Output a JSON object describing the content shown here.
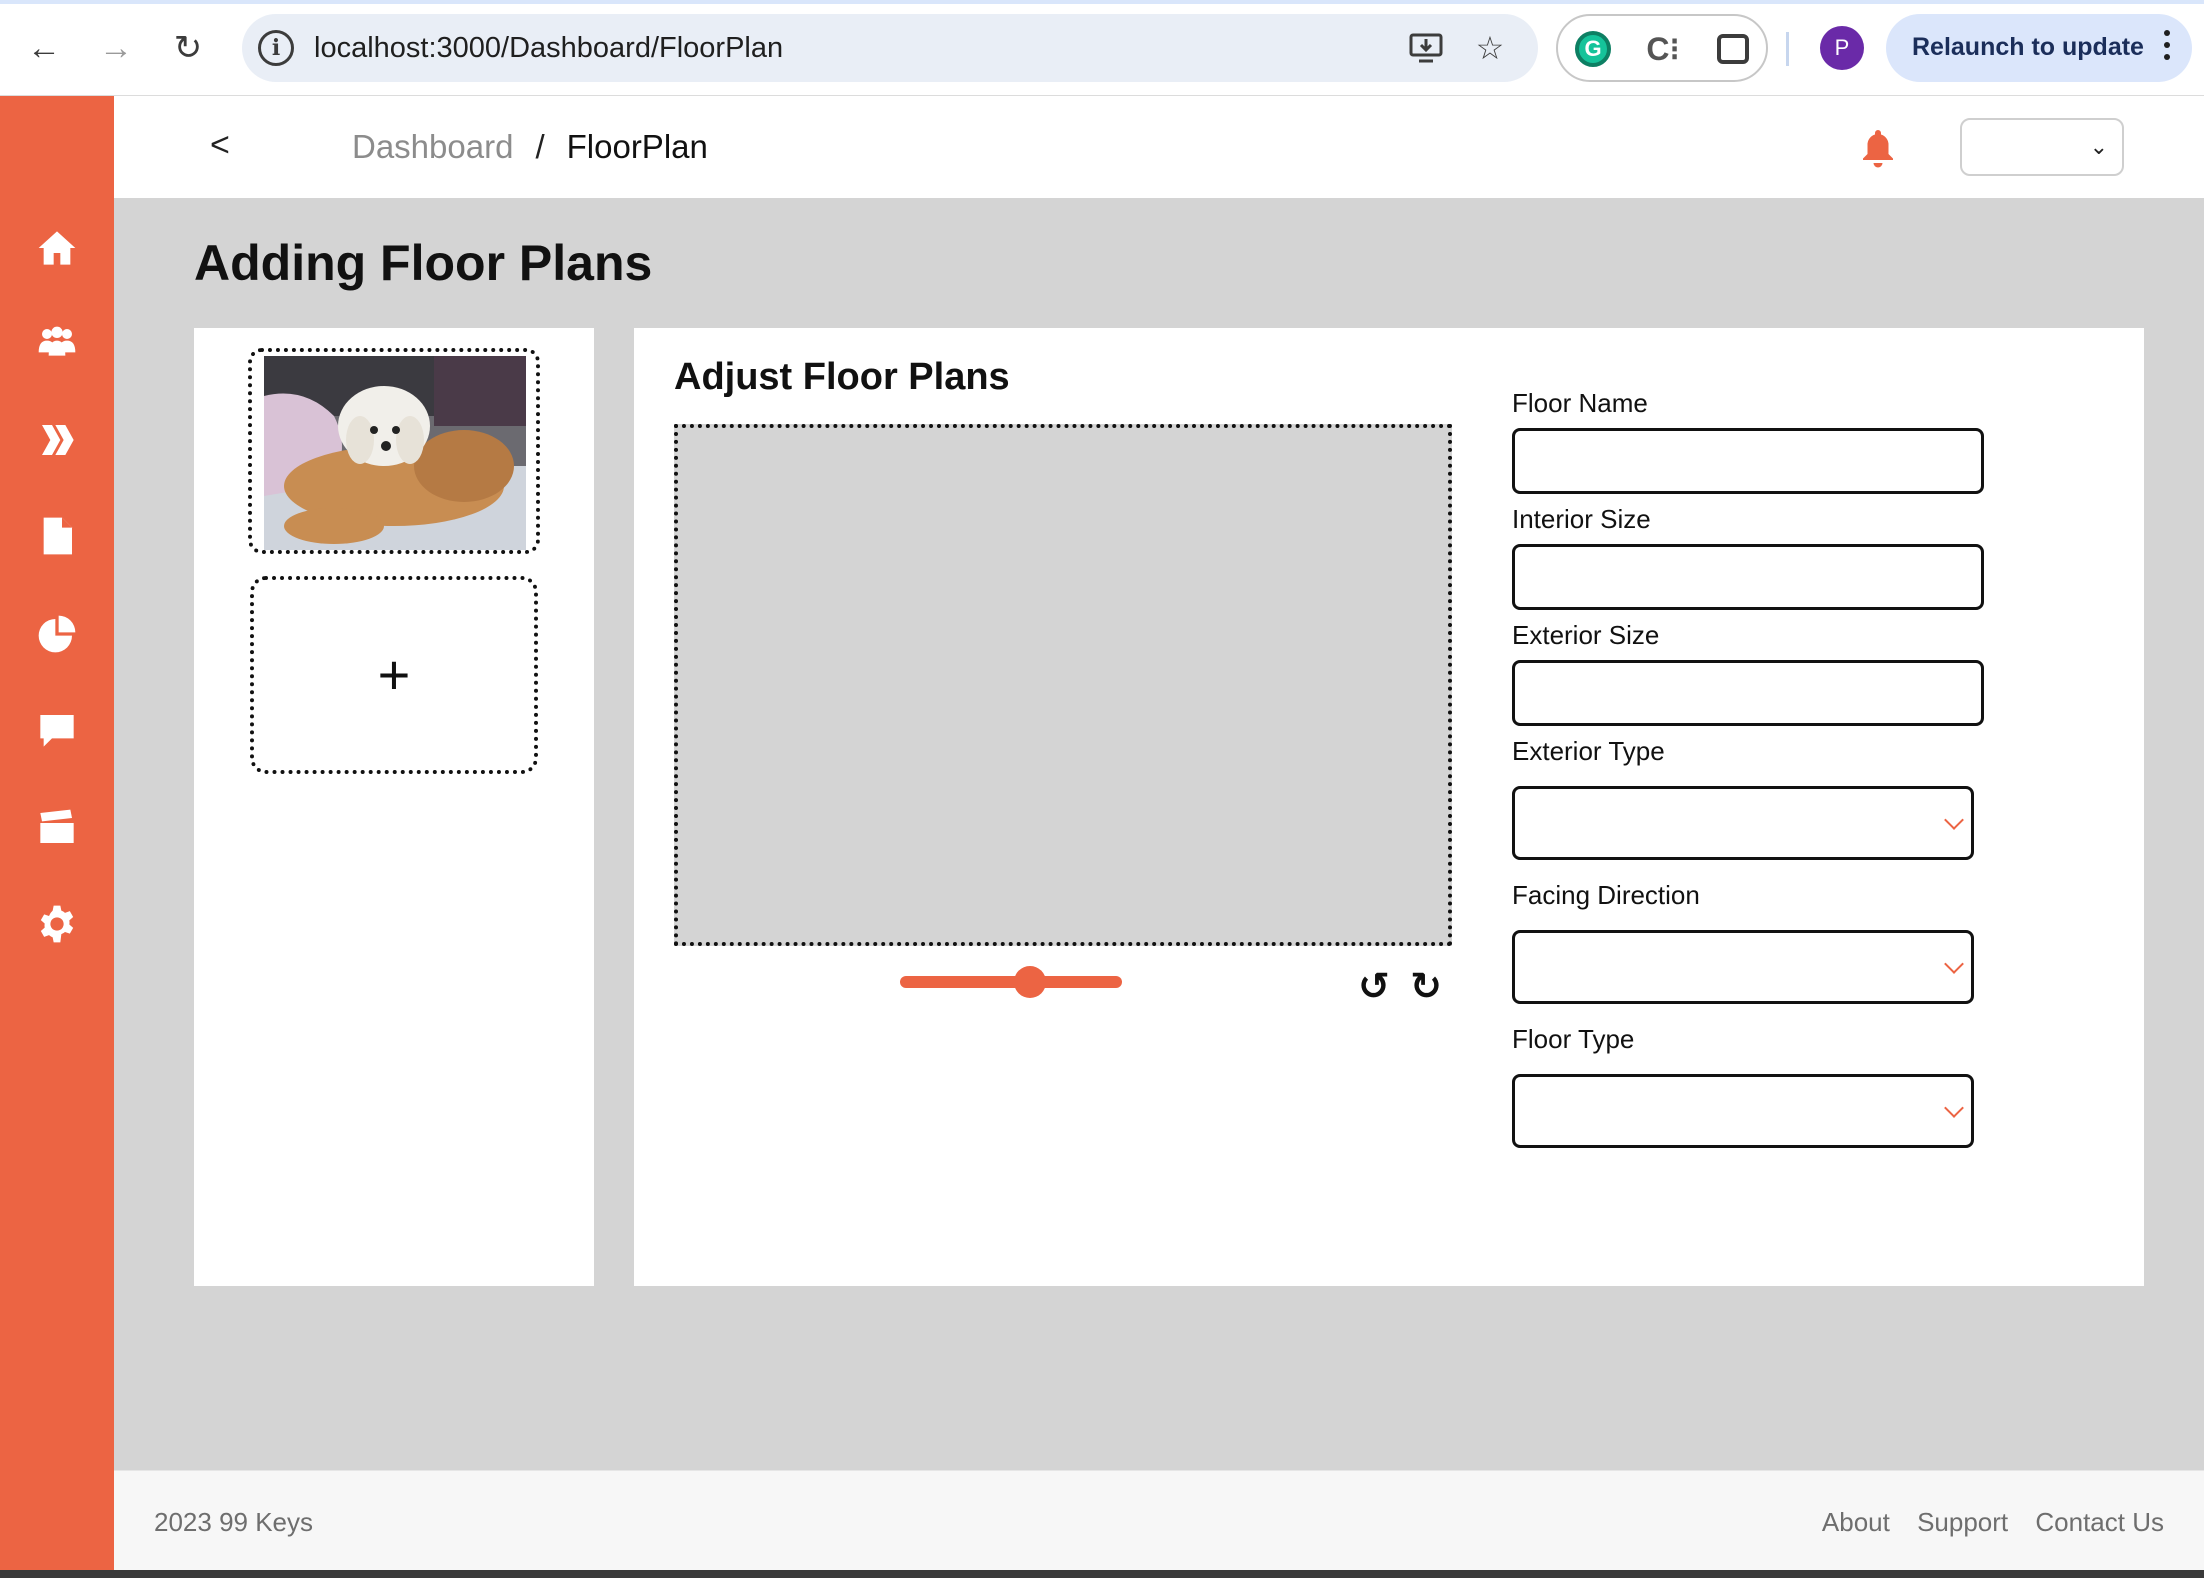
{
  "browser": {
    "url": "localhost:3000/Dashboard/FloorPlan",
    "profile_initial": "P",
    "relaunch_label": "Relaunch to update",
    "extensions": [
      "grammarly-icon",
      "code-c-icon",
      "puzzle-icon"
    ]
  },
  "sidebar": {
    "items": [
      {
        "name": "home-icon"
      },
      {
        "name": "people-icon"
      },
      {
        "name": "pitch-icon"
      },
      {
        "name": "document-icon"
      },
      {
        "name": "chart-pie-icon"
      },
      {
        "name": "chat-icon"
      },
      {
        "name": "clapperboard-icon"
      },
      {
        "name": "settings-icon"
      }
    ],
    "color": "#ec6443"
  },
  "header": {
    "back_label": "<",
    "breadcrumb_parent": "Dashboard",
    "breadcrumb_sep": "/",
    "breadcrumb_current": "FloorPlan",
    "user_select_value": ""
  },
  "main": {
    "page_title": "Adding Floor Plans",
    "add_label": "+",
    "editor_title": "Adjust Floor Plans",
    "zoom_level": 0.6,
    "rotate_left": "↺",
    "rotate_right": "↻",
    "form": {
      "floor_name_label": "Floor Name",
      "floor_name_value": "",
      "interior_size_label": "Interior Size",
      "interior_size_value": "",
      "exterior_size_label": "Exterior Size",
      "exterior_size_value": "",
      "exterior_type_label": "Exterior Type",
      "exterior_type_value": "",
      "facing_direction_label": "Facing Direction",
      "facing_direction_value": "",
      "floor_type_label": "Floor Type",
      "floor_type_value": ""
    }
  },
  "footer": {
    "copyright": "2023 99 Keys",
    "about": "About",
    "support": "Support",
    "contact": "Contact Us"
  },
  "theme": {
    "accent": "#ec6443",
    "background": "#d4d4d4"
  }
}
